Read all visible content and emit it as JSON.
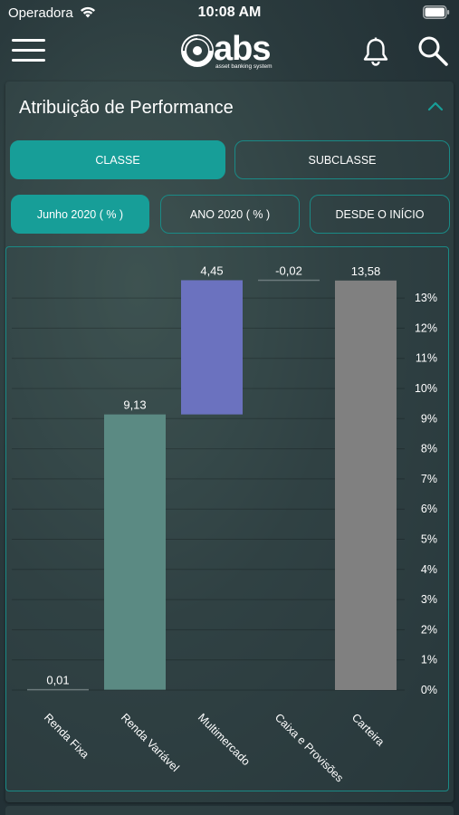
{
  "status_bar": {
    "carrier": "Operadora",
    "time": "10:08 AM",
    "icons": [
      "wifi-icon",
      "battery-icon"
    ]
  },
  "nav_bar": {
    "logo_text": "abs",
    "logo_tagline": "asset banking system",
    "icons": [
      "menu-icon",
      "bell-icon",
      "search-icon"
    ]
  },
  "card": {
    "title": "Atribuição de Performance",
    "collapse_icon": "chevron-up-icon"
  },
  "tabs": {
    "classe": "CLASSE",
    "subclasse": "SUBCLASSE",
    "selected": "classe"
  },
  "periods": {
    "junho": "Junho 2020 ( % )",
    "ano": "ANO 2020 ( % )",
    "inicio": "DESDE O INÍCIO",
    "selected": "junho"
  },
  "colors": {
    "accent": "#179e98",
    "border": "#1a8a86",
    "bar_renda_variavel": "#5b8a83",
    "bar_multimercado": "#6b72bf",
    "bar_carteira": "#808080",
    "baseline": "#6c7a7c"
  },
  "chart_data": {
    "type": "bar",
    "subtype": "waterfall",
    "categories": [
      "Renda Fixa",
      "Renda Variável",
      "Multimercado",
      "Caixa e Provisões",
      "Carteira"
    ],
    "values": [
      0.01,
      9.13,
      4.45,
      -0.02,
      13.58
    ],
    "value_labels": [
      "0,01",
      "9,13",
      "4,45",
      "-0,02",
      "13,58"
    ],
    "ylim": [
      0,
      13.58
    ],
    "yticks": [
      0,
      1,
      2,
      3,
      4,
      5,
      6,
      7,
      8,
      9,
      10,
      11,
      12,
      13
    ],
    "ytick_labels": [
      "0%",
      "1%",
      "2%",
      "3%",
      "4%",
      "5%",
      "6%",
      "7%",
      "8%",
      "9%",
      "10%",
      "11%",
      "12%",
      "13%"
    ],
    "y_axis_side": "right",
    "grid": true,
    "xtick_rotation": "rotated 45 degrees"
  }
}
